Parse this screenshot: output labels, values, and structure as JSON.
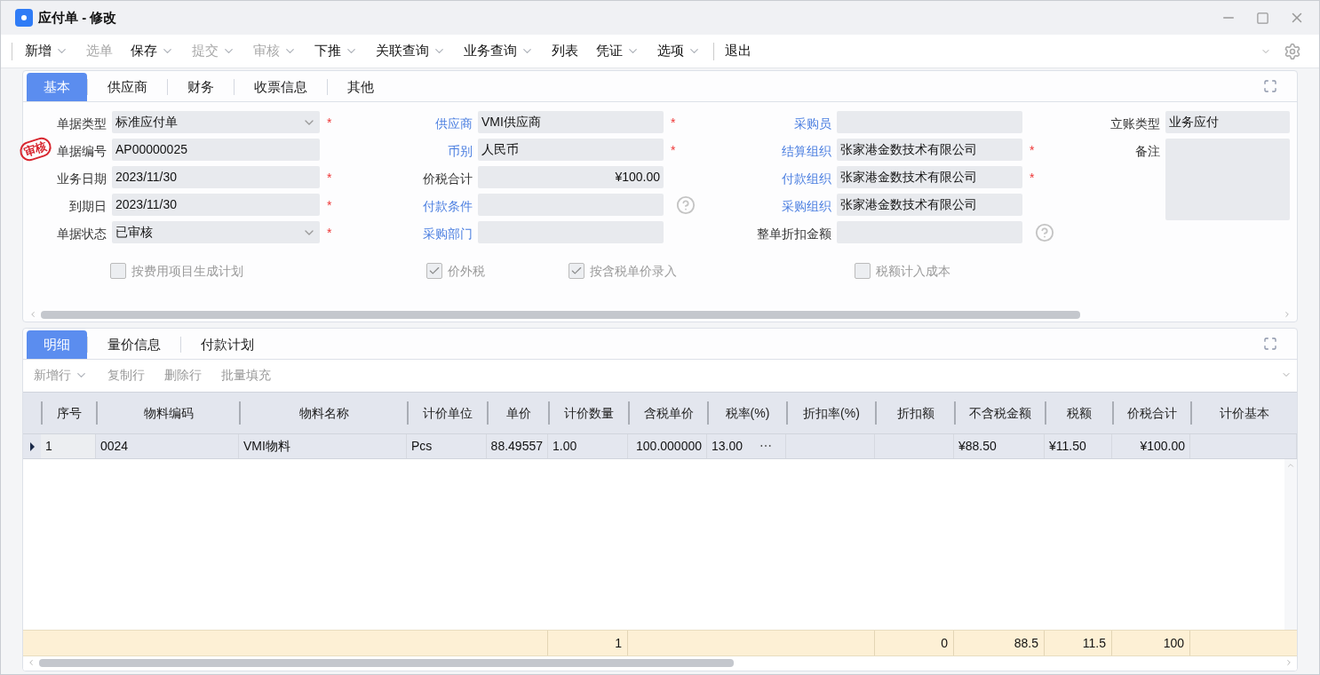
{
  "window": {
    "title": "应付单 - 修改"
  },
  "toolbar": [
    {
      "label": "新增",
      "disabled": false,
      "dropdown": true
    },
    {
      "label": "选单",
      "disabled": true,
      "dropdown": false
    },
    {
      "label": "保存",
      "disabled": false,
      "dropdown": true
    },
    {
      "label": "提交",
      "disabled": true,
      "dropdown": true
    },
    {
      "label": "审核",
      "disabled": true,
      "dropdown": true
    },
    {
      "label": "下推",
      "disabled": false,
      "dropdown": true
    },
    {
      "label": "关联查询",
      "disabled": false,
      "dropdown": true
    },
    {
      "label": "业务查询",
      "disabled": false,
      "dropdown": true
    },
    {
      "label": "列表",
      "disabled": false,
      "dropdown": false
    },
    {
      "label": "凭证",
      "disabled": false,
      "dropdown": true
    },
    {
      "label": "选项",
      "disabled": false,
      "dropdown": true
    },
    {
      "label": "退出",
      "disabled": false,
      "dropdown": false,
      "separator_before": true
    }
  ],
  "header_tabs": [
    {
      "label": "基本",
      "selected": true
    },
    {
      "label": "供应商",
      "selected": false
    },
    {
      "label": "财务",
      "selected": false
    },
    {
      "label": "收票信息",
      "selected": false
    },
    {
      "label": "其他",
      "selected": false
    }
  ],
  "stamp": "审核",
  "form_columns": [
    [
      {
        "label": "单据类型",
        "value": "标准应付单",
        "kind": "select",
        "link": false,
        "required_mark": "*"
      },
      {
        "label": "单据编号",
        "value": "AP00000025",
        "kind": "text",
        "link": false,
        "stamped": true
      },
      {
        "label": "业务日期",
        "value": "2023/11/30",
        "kind": "text",
        "link": false,
        "required_mark": "*"
      },
      {
        "label": "到期日",
        "value": "2023/11/30",
        "kind": "text",
        "link": false,
        "required_mark": "*"
      },
      {
        "label": "单据状态",
        "value": "已审核",
        "kind": "select",
        "link": false,
        "required_mark": "*"
      }
    ],
    [
      {
        "label": "供应商",
        "value": "VMI供应商",
        "kind": "text",
        "link": true,
        "required_mark": "*"
      },
      {
        "label": "币别",
        "value": "人民币",
        "kind": "text",
        "link": true,
        "required_mark": "*"
      },
      {
        "label": "价税合计",
        "value": "¥100.00",
        "kind": "amount",
        "link": false
      },
      {
        "label": "付款条件",
        "kind": "text",
        "link": true,
        "help": true
      },
      {
        "label": "采购部门",
        "kind": "text",
        "link": true
      }
    ],
    [
      {
        "label": "采购员",
        "kind": "text",
        "link": true
      },
      {
        "label": "结算组织",
        "value": "张家港金数技术有限公司",
        "kind": "text",
        "link": true,
        "required_mark": "*"
      },
      {
        "label": "付款组织",
        "value": "张家港金数技术有限公司",
        "kind": "text",
        "link": true,
        "required_mark": "*"
      },
      {
        "label": "采购组织",
        "value": "张家港金数技术有限公司",
        "kind": "text",
        "link": true
      },
      {
        "label": "整单折扣金额",
        "kind": "text",
        "link": false,
        "help": true
      }
    ],
    [
      {
        "label": "立账类型",
        "value": "业务应付",
        "kind": "text",
        "link": false
      },
      {
        "label": "备注",
        "kind": "textarea",
        "link": false
      }
    ]
  ],
  "options": [
    {
      "label": "按费用项目生成计划",
      "checked": false
    },
    {
      "label": "价外税",
      "checked": true
    },
    {
      "label": "按含税单价录入",
      "checked": true
    },
    {
      "label": "税额计入成本",
      "checked": false
    }
  ],
  "detail_tabs": [
    {
      "label": "明细",
      "selected": true
    },
    {
      "label": "量价信息",
      "selected": false
    },
    {
      "label": "付款计划",
      "selected": false
    }
  ],
  "detail_toolbar": [
    {
      "label": "新增行",
      "dropdown": true
    },
    {
      "label": "复制行",
      "dropdown": false
    },
    {
      "label": "删除行",
      "dropdown": false
    },
    {
      "label": "批量填充",
      "dropdown": false
    }
  ],
  "table": {
    "columns": [
      {
        "label": "序号"
      },
      {
        "label": "物料编码"
      },
      {
        "label": "物料名称"
      },
      {
        "label": "计价单位"
      },
      {
        "label": "单价"
      },
      {
        "label": "计价数量",
        "total": "1"
      },
      {
        "label": "含税单价"
      },
      {
        "label": "税率(%)",
        "cell_button": "⋯"
      },
      {
        "label": "折扣率(%)"
      },
      {
        "label": "折扣额",
        "total": "0"
      },
      {
        "label": "不含税金额",
        "total": "88.5"
      },
      {
        "label": "税额",
        "total": "11.5"
      },
      {
        "label": "价税合计",
        "total": "100"
      },
      {
        "label": "计价基本"
      }
    ],
    "rows": [
      {
        "selected": true,
        "cells": [
          "1",
          "0024",
          "VMI物料",
          "Pcs",
          "88.49557",
          "1.00",
          "100.000000",
          "13.00",
          "",
          "",
          "¥88.50",
          "¥11.50",
          "¥100.00",
          ""
        ]
      }
    ]
  }
}
